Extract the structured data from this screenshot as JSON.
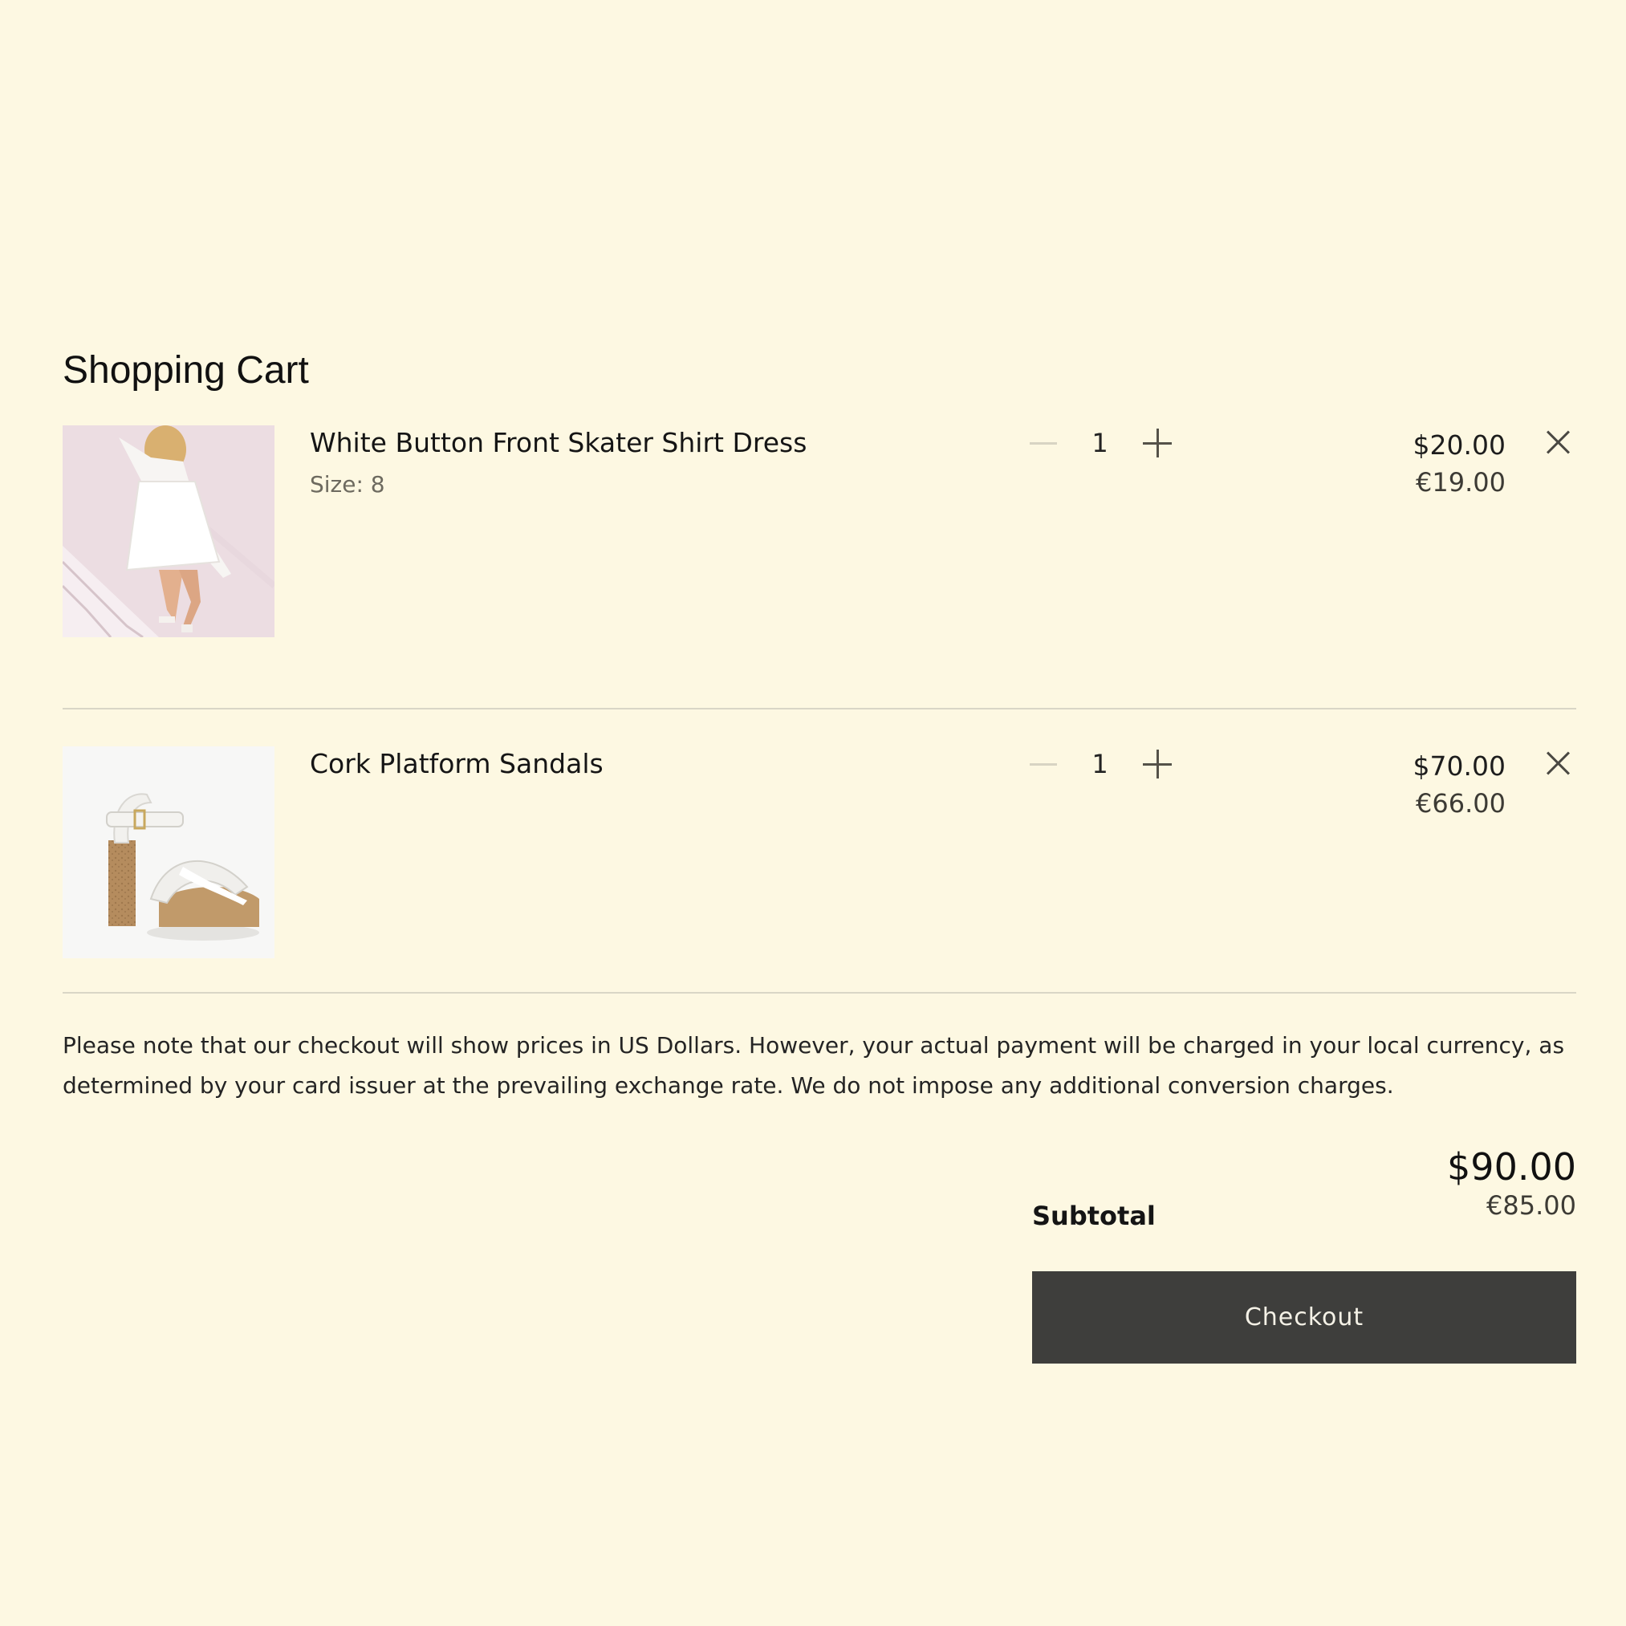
{
  "cart": {
    "title": "Shopping Cart",
    "items": [
      {
        "name": "White Button Front Skater Shirt Dress",
        "size": "Size: 8",
        "quantity": "1",
        "price_usd": "$20.00",
        "price_eur": "€19.00",
        "image": "white-dress-photo"
      },
      {
        "name": "Cork Platform Sandals",
        "quantity": "1",
        "price_usd": "$70.00",
        "price_eur": "€66.00",
        "image": "cork-sandal-photo"
      }
    ],
    "note": "Please note that our checkout will show prices in US Dollars. However, your actual payment will be charged in your local currency, as determined by your card issuer at the prevailing exchange rate. We do not impose any additional conversion charges.",
    "subtotal": {
      "label": "Subtotal",
      "usd": "$90.00",
      "eur": "€85.00"
    },
    "checkout_label": "Checkout"
  },
  "icons": {
    "decrease": "minus-icon",
    "increase": "plus-icon",
    "remove": "close-icon"
  },
  "colors": {
    "background": "#fdf8e2",
    "button": "#3e3e3c",
    "divider": "#d9d6c6"
  }
}
